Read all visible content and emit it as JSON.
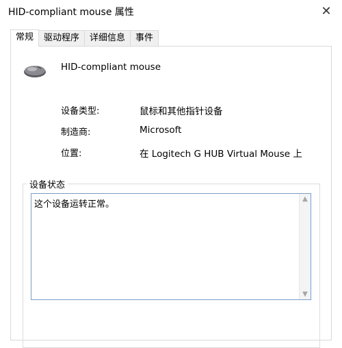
{
  "window": {
    "title": "HID-compliant mouse 属性",
    "close_glyph": "✕"
  },
  "tabs": [
    {
      "label": "常规",
      "active": true
    },
    {
      "label": "驱动程序",
      "active": false
    },
    {
      "label": "详细信息",
      "active": false
    },
    {
      "label": "事件",
      "active": false
    }
  ],
  "device": {
    "name": "HID-compliant mouse",
    "icon": "mouse-icon",
    "properties": [
      {
        "label": "设备类型:",
        "value": "鼠标和其他指针设备"
      },
      {
        "label": "制造商:",
        "value": "Microsoft"
      },
      {
        "label": "位置:",
        "value": "在 Logitech G HUB Virtual Mouse 上"
      }
    ]
  },
  "status": {
    "group_title": "设备状态",
    "text": "这个设备运转正常。"
  },
  "colors": {
    "accent": "#7a9cc6",
    "tab_border": "#d9d9d9"
  }
}
